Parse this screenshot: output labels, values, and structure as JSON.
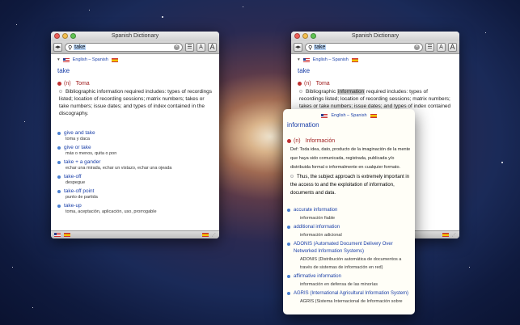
{
  "window_left": {
    "title": "Spanish Dictionary",
    "search_value": "take",
    "lang_label": "English – Spanish",
    "headword": "take",
    "pos": "(n)",
    "translation": "Toma",
    "definition": "Bibliographic information required includes: types of recordings listed; location of recording sessions; matrix numbers; takes or take numbers; issue dates; and types of index contained in the discography.",
    "phrases": [
      {
        "p": "give and take",
        "t": "toma y daca"
      },
      {
        "p": "give or take",
        "t": "más o menos, quita o pon"
      },
      {
        "p": "take + a gander",
        "t": "echar una mirada, echar un vistazo, echar una ojeada"
      },
      {
        "p": "take-off",
        "t": "despegue"
      },
      {
        "p": "take-off point",
        "t": "punto de partida"
      },
      {
        "p": "take-up",
        "t": "toma, aceptación, aplicación, uso, prorrogable"
      }
    ]
  },
  "window_right": {
    "title": "Spanish Dictionary",
    "search_value": "take",
    "lang_label": "English – Spanish",
    "headword": "take",
    "pos": "(n)",
    "translation": "Toma",
    "definition_before": "Bibliographic information required includes: types of recordings listed; location of reco",
    "definition_highlight": "information",
    "definition_line1_start": "Bibliographic",
    "definition_line1_end": "required includes: types of recordings",
    "definition_rest": "listed; location of recording sessions; matrix numbers; takes or take numbers; issue dates; and types of index contained in the discography."
  },
  "popup": {
    "lang_label": "English – Spanish",
    "headword": "information",
    "pos": "(n)",
    "translation": "Información",
    "def_es": "Def: Toda idea, dato, producto de la imaginación de la mente que haya sido comunicada, registrada, publicada y/o distribuida formal o informalmente en cualquier formato.",
    "example": "Thus, the subject approach is extremely important in the access to and the exploitation of information, documents and data.",
    "phrases": [
      {
        "p": "accurate information",
        "t": "información fiable"
      },
      {
        "p": "additional information",
        "t": "información adicional"
      },
      {
        "p": "ADONIS (Automated Document Delivery Over Networked Information Systems)",
        "t": "ADONIS (Distribución automática de documentos a través de sistemas de información en red)"
      },
      {
        "p": "affirmative information",
        "t": "información en defensa de las minorías"
      },
      {
        "p": "AGRIS (International Agricultural Information System)",
        "t": "AGRIS (Sistema Internacional de Información sobre"
      }
    ]
  },
  "colors": {
    "link": "#1a3fa8",
    "pos": "#a02020"
  }
}
